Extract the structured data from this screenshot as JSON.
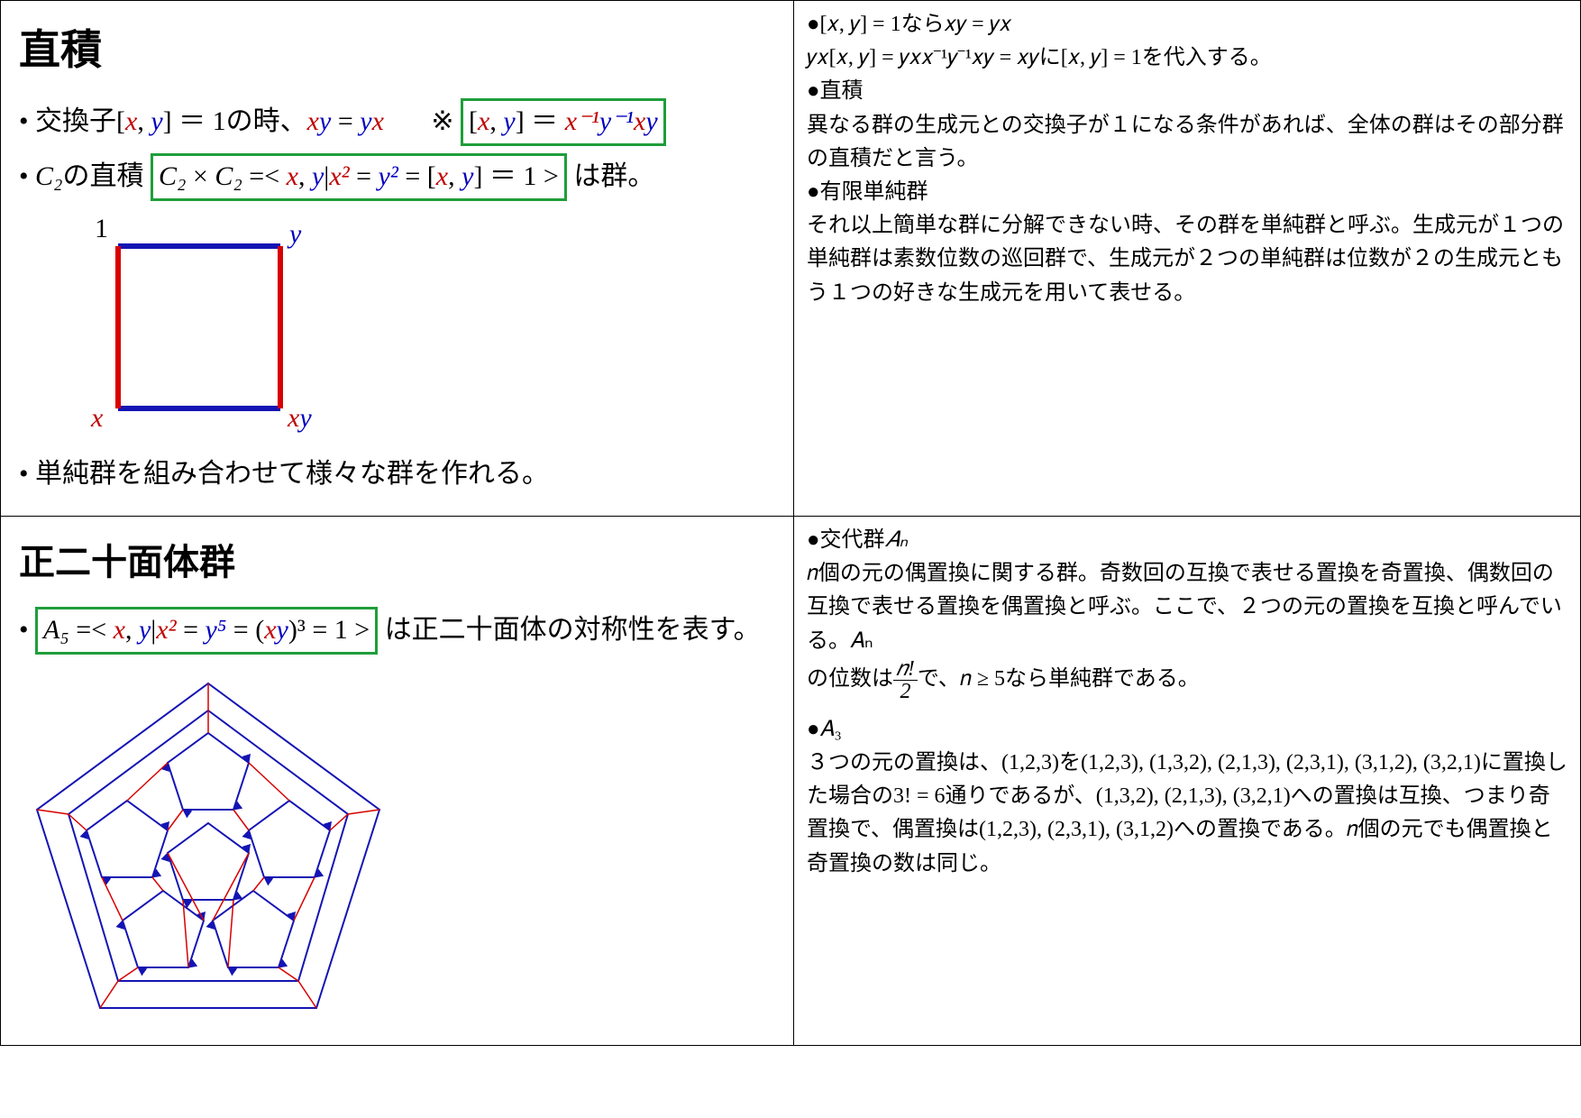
{
  "top": {
    "title": "直積",
    "bullet1_a": "• 交換子[",
    "bullet1_b": "] ＝ 1の時、",
    "x": "x",
    "y": "y",
    "comma": ", ",
    "eq": " = ",
    "yx": "yx",
    "xy": "xy",
    "note_mark": "※",
    "box1_a": "[",
    "box1_b": "] ＝ ",
    "xinv": "x⁻¹",
    "yinv": "y⁻¹",
    "bullet2_a": "• ",
    "c2": "C₂",
    "bullet2_b": "の直積",
    "box2_a": " × ",
    "box2_b": " =< ",
    "box2_c": "|",
    "x2": "x²",
    "y2": "y²",
    "box2_d": " = [",
    "box2_e": "] ＝ 1 >",
    "bullet2_end": "は群。",
    "sq_1": "1",
    "sq_x": "x",
    "sq_y": "y",
    "sq_xy": "xy",
    "bullet3": "• 単純群を組み合わせて様々な群を作れる。"
  },
  "top_right": {
    "l1": "●[𝑥, 𝑦] = 1なら𝑥𝑦 = 𝑦𝑥",
    "l2": "𝑦𝑥[𝑥, 𝑦] = 𝑦𝑥𝑥⁻¹𝑦⁻¹𝑥𝑦 = 𝑥𝑦に[𝑥, 𝑦] = 1を代入する。",
    "l3": "●直積",
    "l4": "異なる群の生成元との交換子が１になる条件があれば、全体の群はその部分群の直積だと言う。",
    "l5": "●有限単純群",
    "l6": "それ以上簡単な群に分解できない時、その群を単純群と呼ぶ。生成元が１つの単純群は素数位数の巡回群で、生成元が２つの単純群は位数が２の生成元ともう１つの好きな生成元を用いて表せる。"
  },
  "bottom": {
    "title": "正二十面体群",
    "bullet1_a": "• ",
    "a5": "A₅",
    "box_a": " =< ",
    "box_b": "|",
    "x2": "x²",
    "y5": "y⁵",
    "xy3_a": "(",
    "xy3_b": ")³",
    "box_c": " = 1 >",
    "bullet1_end": " は正二十面体の対称性を表す。",
    "x": "x",
    "y": "y"
  },
  "bottom_right": {
    "l1a": "●交代群",
    "l1b": "𝐴ₙ",
    "l2": "𝑛個の元の偶置換に関する群。奇数回の互換で表せる置換を奇置換、偶数回の互換で表せる置換を偶置換と呼ぶ。ここで、２つの元の置換を互換と呼んでいる。𝐴ₙ",
    "l3a": "の位数は",
    "frac_num": "𝑛!",
    "frac_den": "2",
    "l3b": "で、𝑛 ≥ 5なら単純群である。",
    "l4": "●𝐴₃",
    "l5": "３つの元の置換は、(1,2,3)を(1,2,3), (1,3,2), (2,1,3), (2,3,1), (3,1,2), (3,2,1)に置換した場合の3! = 6通りであるが、(1,3,2), (2,1,3), (3,2,1)への置換は互換、つまり奇置換で、偶置換は(1,2,3), (2,3,1), (3,1,2)への置換である。𝑛個の元でも偶置換と奇置換の数は同じ。"
  }
}
